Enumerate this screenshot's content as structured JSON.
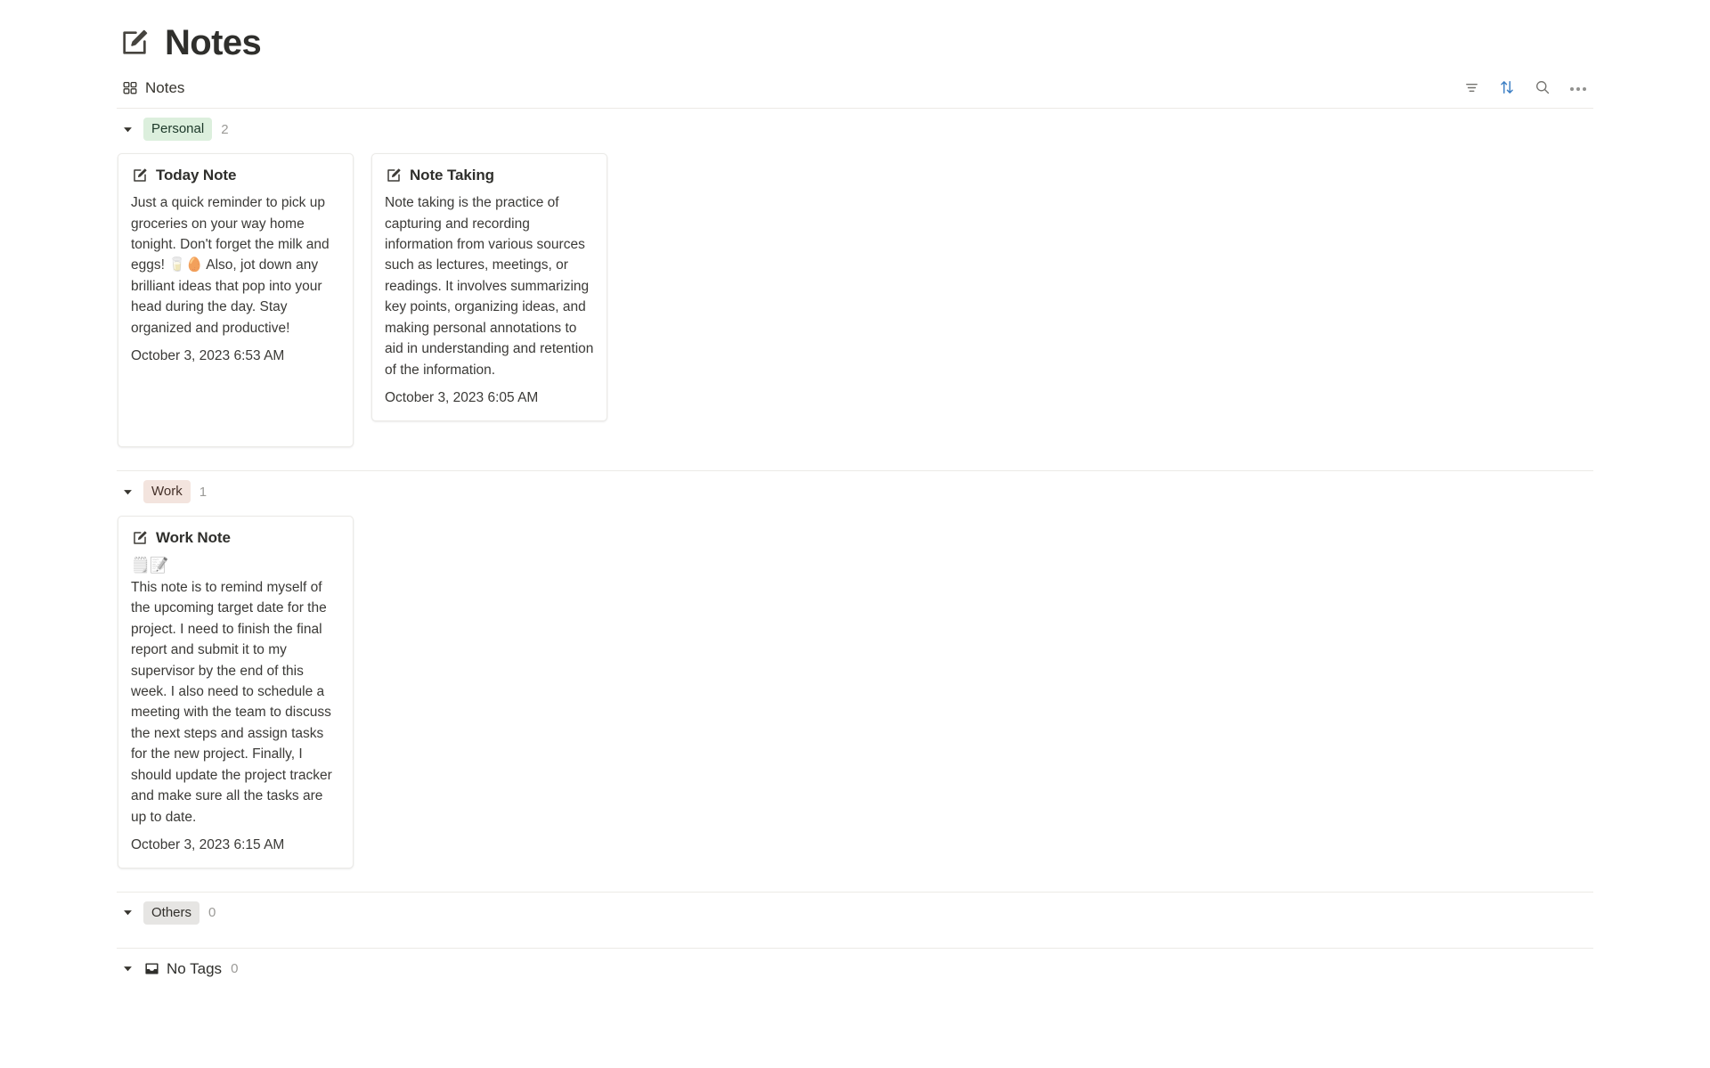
{
  "header": {
    "title": "Notes",
    "icon": "note-edit-icon"
  },
  "view_bar": {
    "tab_label": "Notes",
    "tab_icon": "gallery-grid-icon",
    "actions": [
      {
        "name": "filter-button",
        "icon": "filter-icon",
        "label": "Filter",
        "color": "#73726e"
      },
      {
        "name": "sort-button",
        "icon": "sort-arrows-icon",
        "label": "Sort",
        "color": "#3b7ec4"
      },
      {
        "name": "search-button",
        "icon": "search-icon",
        "label": "Search",
        "color": "#73726e"
      },
      {
        "name": "more-options-button",
        "icon": "ellipsis-icon",
        "label": "More options",
        "color": "#91918e"
      }
    ]
  },
  "groups": [
    {
      "id": "personal",
      "label": "Personal",
      "count": "2",
      "pill_style": "pill-green",
      "pill_bg": "#dcefdd",
      "pill_text": "#1c3829",
      "collapsed": false,
      "cards": [
        {
          "id": "today-note",
          "title": "Today Note",
          "icon": "note-edit-icon",
          "emoji": "",
          "body": "Just a quick reminder to pick up groceries on your way home tonight. Don't forget the milk and eggs! 🥛🥚 Also, jot down any brilliant ideas that pop into your head during the day. Stay organized and productive!",
          "date": "October 3, 2023 6:53 AM"
        },
        {
          "id": "note-taking",
          "title": "Note Taking",
          "icon": "note-edit-icon",
          "emoji": "",
          "body": "Note taking is the practice of capturing and recording information from various sources such as lectures, meetings, or readings. It involves summarizing key points, organizing ideas, and making personal annotations to aid in understanding and retention of the information.",
          "date": "October 3, 2023 6:05 AM"
        }
      ]
    },
    {
      "id": "work",
      "label": "Work",
      "count": "1",
      "pill_style": "pill-brown",
      "pill_bg": "#f3e4de",
      "pill_text": "#443029",
      "collapsed": false,
      "cards": [
        {
          "id": "work-note",
          "title": "Work Note",
          "icon": "note-edit-icon",
          "emoji": "🗒️📝",
          "body": "This note is to remind myself of the upcoming target date for the project. I need to finish the final report and submit it to my supervisor by the end of this week. I also need to schedule a meeting with the team to discuss the next steps and assign tasks for the new project. Finally, I should update the project tracker and make sure all the tasks are up to date.",
          "date": "October 3, 2023 6:15 AM"
        }
      ]
    },
    {
      "id": "others",
      "label": "Others",
      "count": "0",
      "pill_style": "pill-gray",
      "pill_bg": "#e6e5e3",
      "pill_text": "#32302c",
      "collapsed": false,
      "cards": []
    },
    {
      "id": "no-tags",
      "label": "No Tags",
      "count": "0",
      "pill_style": "plain",
      "icon": "inbox-icon",
      "collapsed": false,
      "cards": []
    }
  ]
}
